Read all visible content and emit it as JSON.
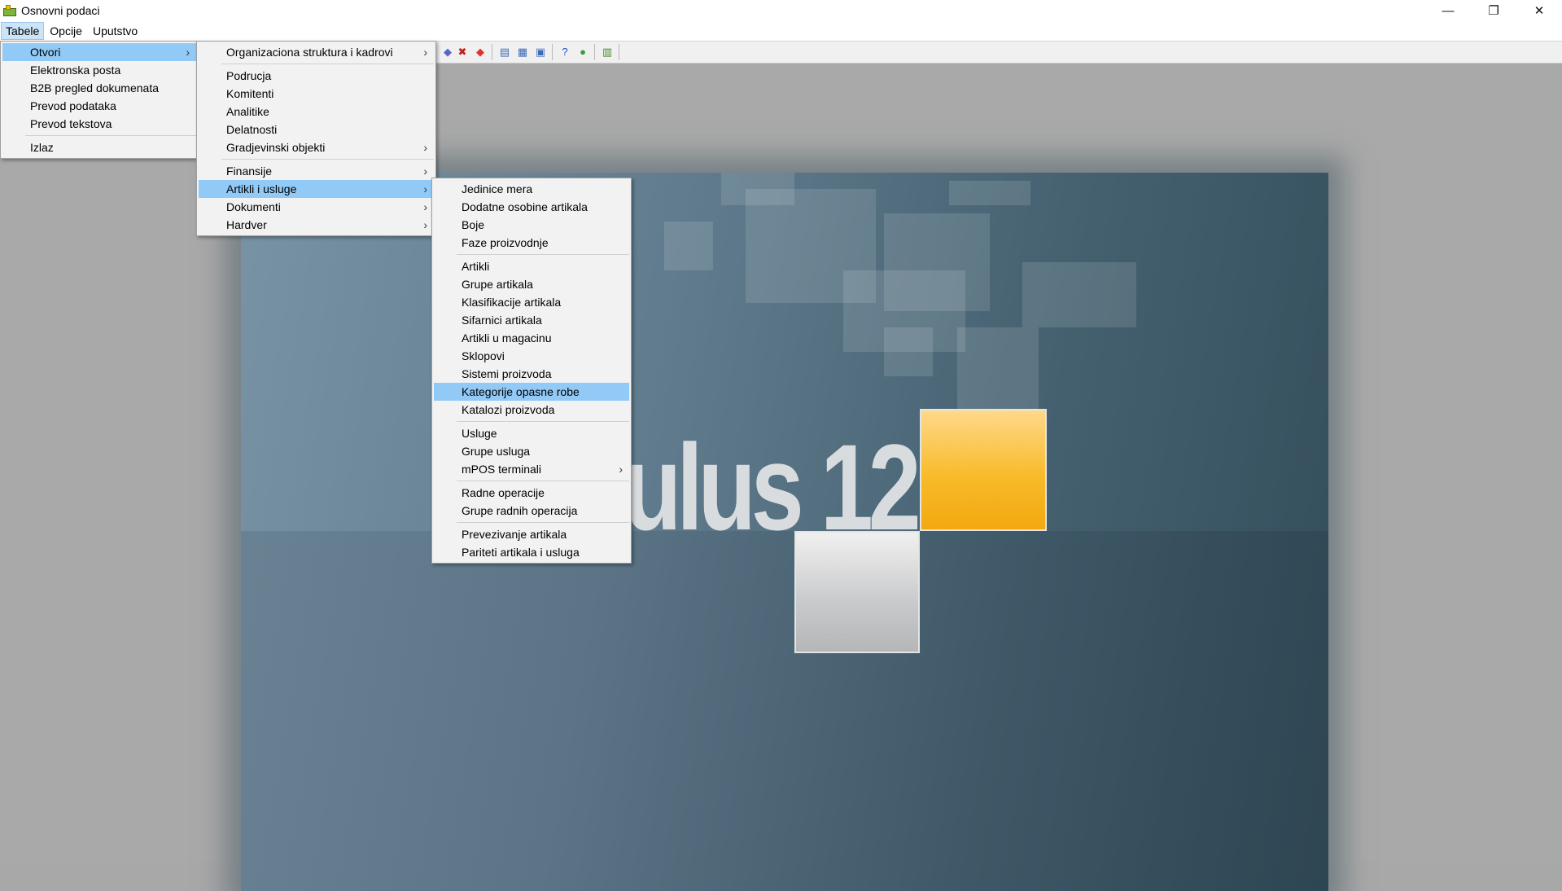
{
  "window": {
    "title": "Osnovni podaci",
    "controls": {
      "minimize": "—",
      "restore": "❐",
      "close": "✕"
    }
  },
  "menubar": [
    "Tabele",
    "Opcije",
    "Uputstvo"
  ],
  "splash": {
    "logo_text": "ulus 12"
  },
  "menu_tabele": {
    "items": [
      {
        "label": "Otvori",
        "submenu": true,
        "highlight": true
      },
      {
        "label": "Elektronska posta"
      },
      {
        "label": "B2B pregled dokumenata"
      },
      {
        "label": "Prevod podataka"
      },
      {
        "label": "Prevod tekstova"
      },
      {
        "separator": true
      },
      {
        "label": "Izlaz"
      }
    ]
  },
  "menu_otvori": {
    "items": [
      {
        "label": "Organizaciona struktura i kadrovi",
        "submenu": true
      },
      {
        "separator": true
      },
      {
        "label": "Podrucja"
      },
      {
        "label": "Komitenti"
      },
      {
        "label": "Analitike"
      },
      {
        "label": "Delatnosti"
      },
      {
        "label": "Gradjevinski objekti",
        "submenu": true
      },
      {
        "separator": true
      },
      {
        "label": "Finansije",
        "submenu": true
      },
      {
        "label": "Artikli i usluge",
        "submenu": true,
        "highlight": true
      },
      {
        "label": "Dokumenti",
        "submenu": true
      },
      {
        "label": "Hardver",
        "submenu": true
      }
    ]
  },
  "menu_artikli": {
    "items": [
      {
        "label": "Jedinice mera"
      },
      {
        "label": "Dodatne osobine artikala"
      },
      {
        "label": "Boje"
      },
      {
        "label": "Faze proizvodnje"
      },
      {
        "separator": true
      },
      {
        "label": "Artikli"
      },
      {
        "label": "Grupe artikala"
      },
      {
        "label": "Klasifikacije artikala"
      },
      {
        "label": "Sifarnici artikala"
      },
      {
        "label": "Artikli u magacinu"
      },
      {
        "label": "Sklopovi"
      },
      {
        "label": "Sistemi proizvoda"
      },
      {
        "label": "Kategorije opasne robe",
        "highlight": true
      },
      {
        "label": "Katalozi proizvoda"
      },
      {
        "separator": true
      },
      {
        "label": "Usluge"
      },
      {
        "label": "Grupe usluga"
      },
      {
        "label": "mPOS terminali",
        "submenu": true
      },
      {
        "separator": true
      },
      {
        "label": "Radne operacije"
      },
      {
        "label": "Grupe radnih operacija"
      },
      {
        "separator": true
      },
      {
        "label": "Prevezivanje artikala"
      },
      {
        "label": "Pariteti artikala i usluga"
      }
    ]
  },
  "colors": {
    "highlight": "#91c9f7",
    "orange": "#f8bb2a"
  }
}
